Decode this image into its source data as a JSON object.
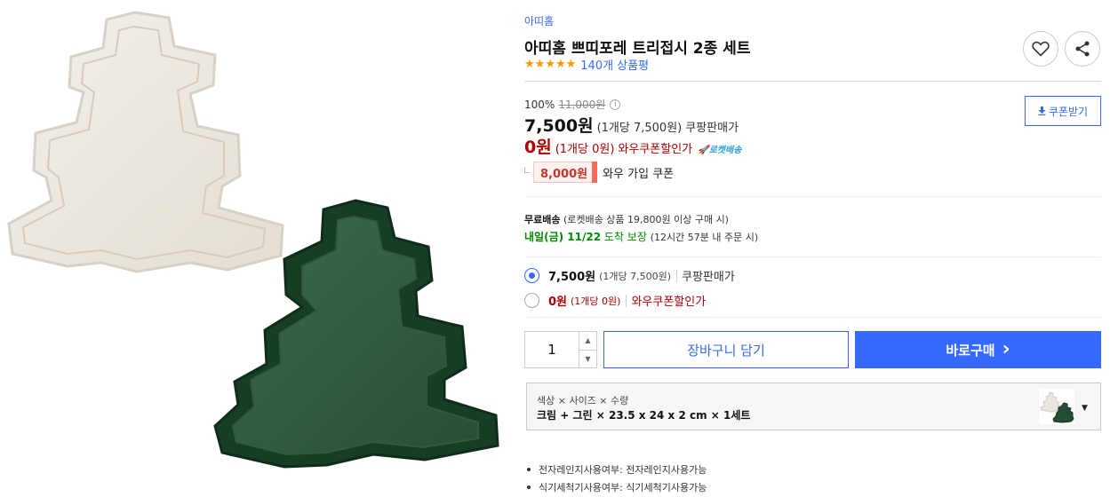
{
  "product": {
    "brand": "아띠홈",
    "title": "아띠홈 쁘띠포레 트리접시 2종 세트",
    "rating": 5,
    "review_count": "140개 상품평"
  },
  "price": {
    "discount_rate": "100%",
    "original_price": "11,000원",
    "info_glyph": "i",
    "main_amount": "7,500원",
    "main_unit": "(1개당 7,500원)",
    "main_seller": "쿠팡판매가",
    "wow_amount": "0원",
    "wow_unit": "(1개당 0원)",
    "wow_label": "와우쿠폰할인가",
    "rocket_label": "로켓배송",
    "coupon_amount": "8,000원",
    "coupon_label": "와우 가입 쿠폰"
  },
  "coupon_button": {
    "label": "쿠폰받기"
  },
  "shipping": {
    "free_label": "무료배송",
    "condition": "(로켓배송 상품 19,800원 이상 구매 시)",
    "arrival_when": "내일(금) 11/22",
    "arrival_guarantee": "도착 보장",
    "arrival_note": "(12시간 57분 내 주문 시)"
  },
  "price_options": [
    {
      "amount": "7,500원",
      "unit": "(1개당 7,500원)",
      "label": "쿠팡판매가",
      "selected": true
    },
    {
      "amount": "0원",
      "unit": "(1개당 0원)",
      "label": "와우쿠폰할인가",
      "selected": false
    }
  ],
  "purchase": {
    "quantity": "1",
    "cart_label": "장바구니 담기",
    "buy_label": "바로구매",
    "buy_arrow": "›"
  },
  "option_select": {
    "header": "색상 × 사이즈 × 수량",
    "value": "크림 + 그린 × 23.5 x 24 x 2 cm × 1세트"
  },
  "specs": [
    "전자레인지사용여부: 전자레인지사용가능",
    "식기세척기사용여부: 식기세척기사용가능"
  ],
  "icons": {
    "favorite": "heart-icon",
    "share": "share-icon",
    "download": "download-icon",
    "rocket": "rocket-icon"
  },
  "colors": {
    "accent": "#346aff",
    "price_red": "#ae0000",
    "star": "#ff9600",
    "arrival_green": "#008c00",
    "plate_cream": "#ebe6dd",
    "plate_green": "#1c4a2c"
  }
}
